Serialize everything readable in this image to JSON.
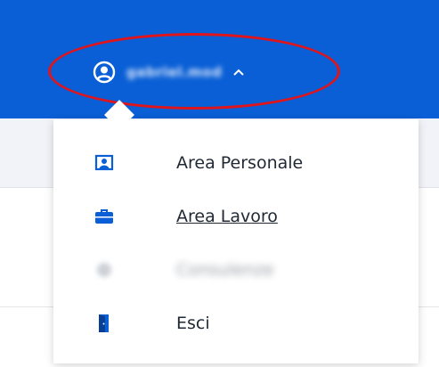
{
  "header": {
    "user_name": "gabriel.mod",
    "caret_icon": "chevron-up-icon",
    "user_icon": "user-circle-icon",
    "background_color": "#0a5fd6",
    "highlight_color": "#e0141b"
  },
  "dropdown": {
    "items": [
      {
        "label": "Area Personale",
        "icon": "id-badge-icon"
      },
      {
        "label": "Area Lavoro",
        "icon": "briefcase-icon"
      },
      {
        "label": "Consulenze",
        "icon": "blurred-icon"
      },
      {
        "label": "Esci",
        "icon": "door-exit-icon"
      }
    ],
    "icon_color": "#0a5fd6"
  }
}
